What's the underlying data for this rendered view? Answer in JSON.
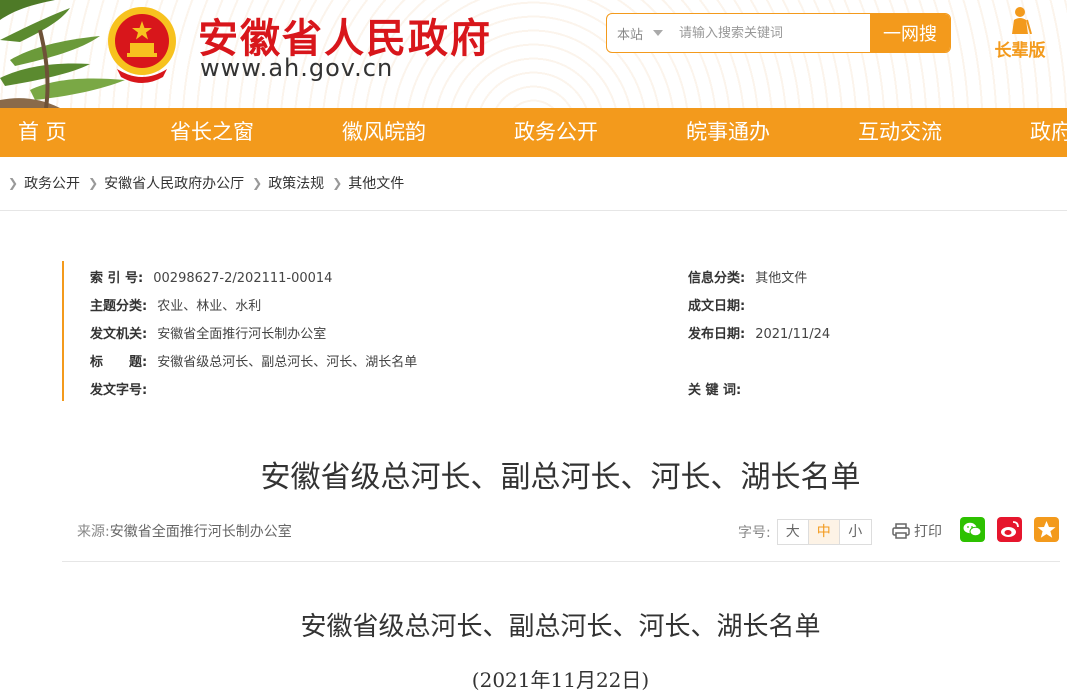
{
  "header": {
    "site_title": "安徽省人民政府",
    "site_url": "www.ah.gov.cn",
    "search": {
      "scope": "本站",
      "placeholder": "请输入搜索关键词",
      "button": "一网搜"
    },
    "elder_mode": "长辈版"
  },
  "nav": {
    "items": [
      {
        "label": "首 页"
      },
      {
        "label": "省长之窗"
      },
      {
        "label": "徽风皖韵"
      },
      {
        "label": "政务公开"
      },
      {
        "label": "皖事通办"
      },
      {
        "label": "互动交流"
      },
      {
        "label": "政府"
      }
    ]
  },
  "breadcrumb": [
    "政务公开",
    "安徽省人民政府办公厅",
    "政策法规",
    "其他文件"
  ],
  "info": {
    "index_no": {
      "key": "索 引 号:",
      "value": "00298627-2/202111-00014"
    },
    "topic": {
      "key": "主题分类:",
      "value": "农业、林业、水利"
    },
    "issuer": {
      "key": "发文机关:",
      "value": "安徽省全面推行河长制办公室"
    },
    "title": {
      "key": "标　　题:",
      "value": "安徽省级总河长、副总河长、河长、湖长名单"
    },
    "doc_no": {
      "key": "发文字号:",
      "value": ""
    },
    "category": {
      "key": "信息分类:",
      "value": "其他文件"
    },
    "written_date": {
      "key": "成文日期:",
      "value": ""
    },
    "publish_date": {
      "key": "发布日期:",
      "value": "2021/11/24"
    },
    "keywords": {
      "key": "关 键 词:",
      "value": ""
    }
  },
  "article": {
    "title": "安徽省级总河长、副总河长、河长、湖长名单",
    "source_label": "来源:",
    "source": "安徽省全面推行河长制办公室",
    "font_label": "字号:",
    "font_sizes": [
      "大",
      "中",
      "小"
    ],
    "print": "打印",
    "body_title": "安徽省级总河长、副总河长、河长、湖长名单",
    "body_date": "(2021年11月22日)"
  },
  "colors": {
    "brand_orange": "#f39a1c",
    "title_red": "#d8161b",
    "wechat": "#2dc100",
    "weibo": "#e6162d",
    "favorite": "#f39a1c"
  }
}
